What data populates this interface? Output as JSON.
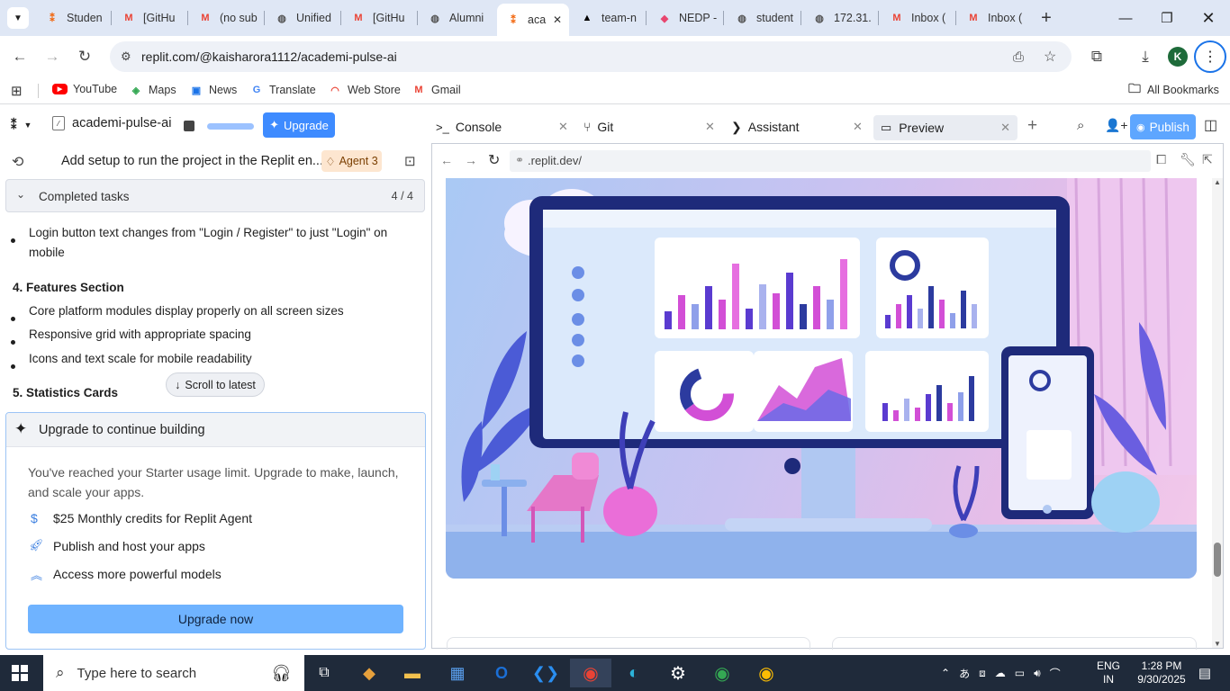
{
  "browser": {
    "tabs": [
      {
        "label": "Studen",
        "icon": "replit-icon"
      },
      {
        "label": "[GitHu",
        "icon": "gmail-icon"
      },
      {
        "label": "(no sub",
        "icon": "gmail-icon"
      },
      {
        "label": "Unified",
        "icon": "globe-icon"
      },
      {
        "label": "[GitHu",
        "icon": "gmail-icon"
      },
      {
        "label": "Alumni",
        "icon": "globe-icon"
      },
      {
        "label": "aca",
        "icon": "replit-icon",
        "active": true
      },
      {
        "label": "team-n",
        "icon": "vercel-icon"
      },
      {
        "label": "NEDP -",
        "icon": "app-icon"
      },
      {
        "label": "student",
        "icon": "globe-icon"
      },
      {
        "label": "172.31.",
        "icon": "globe-icon"
      },
      {
        "label": "Inbox (",
        "icon": "gmail-icon"
      },
      {
        "label": "Inbox (",
        "icon": "gmail-icon"
      }
    ],
    "url": "replit.com/@kaisharora1112/academi-pulse-ai",
    "profile_initial": "K",
    "bookmarks": [
      {
        "label": "YouTube",
        "icon": "youtube-icon"
      },
      {
        "label": "Maps",
        "icon": "maps-icon"
      },
      {
        "label": "News",
        "icon": "news-icon"
      },
      {
        "label": "Translate",
        "icon": "translate-icon"
      },
      {
        "label": "Web Store",
        "icon": "webstore-icon"
      },
      {
        "label": "Gmail",
        "icon": "gmail-icon"
      }
    ],
    "all_bookmarks": "All Bookmarks"
  },
  "replit": {
    "project_name": "academi-pulse-ai",
    "upgrade_label": "Upgrade",
    "panel_tabs": [
      {
        "label": "Console",
        "icon": "console-icon"
      },
      {
        "label": "Git",
        "icon": "git-icon"
      },
      {
        "label": "Assistant",
        "icon": "assistant-icon"
      },
      {
        "label": "Preview",
        "icon": "preview-icon"
      }
    ],
    "publish_label": "Publish",
    "chat_title": "Add setup to run the project in the Replit en...",
    "agent_badge": "Agent 3",
    "completed_tasks": {
      "label": "Completed tasks",
      "count": "4 / 4"
    },
    "content": {
      "bullet_1": "Login button text changes from \"Login / Register\" to just \"Login\" on",
      "bullet_1b": "mobile",
      "section_4": "4. Features Section",
      "bullet_2": "Core platform modules display properly on all screen sizes",
      "bullet_3": "Responsive grid with appropriate spacing",
      "bullet_4": "Icons and text scale for mobile readability",
      "section_5": "5. Statistics Cards"
    },
    "scroll_to_latest": "Scroll to latest",
    "upgrade_card": {
      "title": "Upgrade to continue building",
      "description_1": "You've reached your Starter usage limit. Upgrade to make, launch,",
      "description_2": "and scale your apps.",
      "features": [
        {
          "icon": "dollar-icon",
          "label": "$25 Monthly credits for Replit Agent"
        },
        {
          "icon": "rocket-icon",
          "label": "Publish and host your apps"
        },
        {
          "icon": "chevrons-up-icon",
          "label": "Access more powerful models"
        }
      ],
      "button": "Upgrade now"
    },
    "preview_url": ".replit.dev/"
  },
  "taskbar": {
    "search_placeholder": "Type here to search",
    "lang_1": "ENG",
    "lang_2": "IN",
    "time": "1:28 PM",
    "date": "9/30/2025"
  },
  "colors": {
    "accent": "#0b57d0",
    "replit_blue": "#5c9dff",
    "upgrade_btn": "#6fb3ff",
    "taskbar": "#1f2a3a",
    "tabstrip": "#dfe7f5"
  }
}
